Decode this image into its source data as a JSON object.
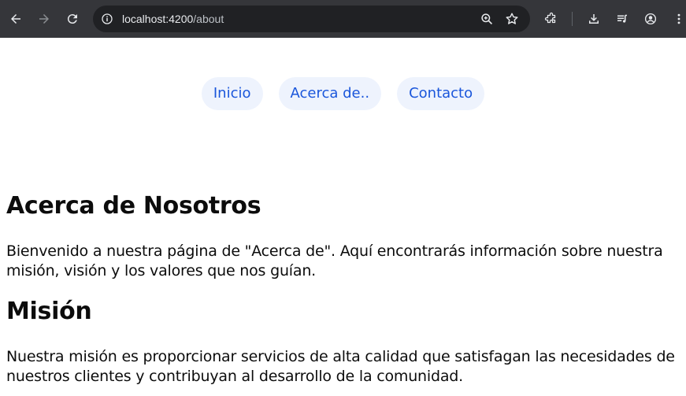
{
  "browser": {
    "url_host": "localhost:4200",
    "url_path": "/about",
    "icons": [
      "back-icon",
      "forward-icon",
      "reload-icon",
      "site-info-icon",
      "zoom-icon",
      "bookmark-star-icon",
      "extensions-icon",
      "download-icon",
      "media-control-icon",
      "profile-icon",
      "menu-icon"
    ]
  },
  "nav": {
    "items": [
      {
        "label": "Inicio"
      },
      {
        "label": "Acerca de.."
      },
      {
        "label": "Contacto"
      }
    ]
  },
  "main": {
    "title": "Acerca de Nosotros",
    "intro": "Bienvenido a nuestra página de \"Acerca de\". Aquí encontrarás información sobre nuestra misión, visión y los valores que nos guían.",
    "mission_heading": "Misión",
    "mission_text": "Nuestra misión es proporcionar servicios de alta calidad que satisfagan las necesidades de nuestros clientes y contribuyan al desarrollo de la comunidad."
  },
  "colors": {
    "toolbar_bg": "#35363a",
    "omnibox_bg": "#202124",
    "nav_link_text": "#1a56db",
    "nav_link_bg": "#eef3fd"
  }
}
